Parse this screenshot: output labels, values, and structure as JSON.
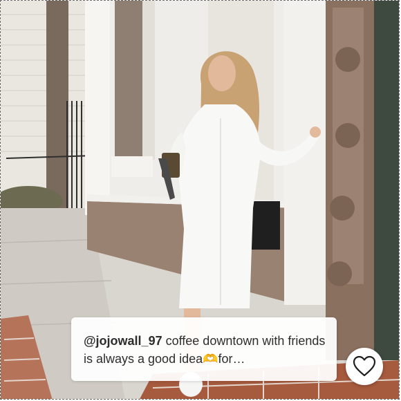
{
  "post": {
    "username": "@jojowall_97",
    "caption": " coffee downtown with friends is always a good idea🫶for…"
  },
  "like_button": {
    "icon": "heart-outline-icon"
  },
  "colors": {
    "caption_bg": "#ffffff",
    "text": "#2d2d2d",
    "wall": "#e6e2dc",
    "door": "#8f7666"
  }
}
